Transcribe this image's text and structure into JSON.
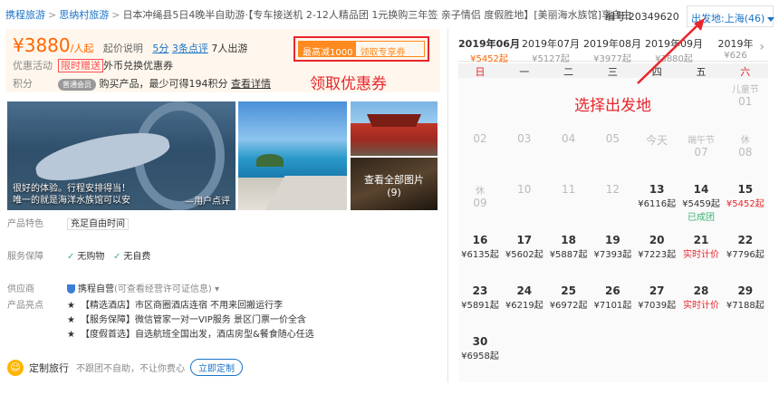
{
  "breadcrumb": {
    "item1": "携程旅游",
    "item2": "思纳村旅游",
    "title": "日本冲绳县5日4晚半自助游·【专车接送机 2-12人精品团 1元换购三年签 亲子情侣 度假胜地】[美丽海水族馆]享自由"
  },
  "product_number": "编号:20349620",
  "departure": {
    "label": "出发地:上海(46)"
  },
  "price": {
    "currency": "¥",
    "amount": "3880",
    "unit": "/人起",
    "explain": "起价说明",
    "score": "5分",
    "reviews": "3条点评",
    "travelers": "7人出游"
  },
  "promo": {
    "label": "优惠活动",
    "tag": "限时赠送",
    "text": "外币兑换优惠券"
  },
  "points": {
    "label": "积分",
    "pill": "普通会员",
    "text": "购买产品，最少可得194积分",
    "link": "查看详情"
  },
  "coupon": {
    "a": "最高减1000",
    "b": "领取专享券"
  },
  "annotations": {
    "coupon_note": "领取优惠券",
    "departure_note": "选择出发地"
  },
  "images": {
    "main_caption_1": "很好的体验。行程安排得当！",
    "main_caption_2": "唯一的就是海洋水族馆可以安",
    "main_caption_3": "—用户点评",
    "all_label": "查看全部图片",
    "all_count": "(9)"
  },
  "attributes": {
    "feature_k": "产品特色",
    "feature_v": "充足自由时间",
    "guarantee_k": "服务保障",
    "guarantee_v1": "无购物",
    "guarantee_v2": "无自费",
    "supplier_k": "供应商",
    "supplier_v": "携程自营",
    "supplier_note": "(可查看经营许可证信息)",
    "highlight_k": "产品亮点",
    "h1": "【精选酒店】市区商圈酒店连宿 不用来回搬运行李",
    "h2": "【服务保障】微信管家一对一VIP服务 景区门票一价全含",
    "h3": "【度假首选】自选航班全国出发，酒店房型&餐食随心任选"
  },
  "custom": {
    "icon": "☺",
    "title": "定制旅行",
    "sub": "不跟团不自助，不让你费心",
    "button": "立即定制"
  },
  "calendar": {
    "months": [
      {
        "m": "2019年06月",
        "p": "¥5452起"
      },
      {
        "m": "2019年07月",
        "p": "¥5127起"
      },
      {
        "m": "2019年08月",
        "p": "¥3977起"
      },
      {
        "m": "2019年09月",
        "p": "¥3880起"
      },
      {
        "m": "2019年",
        "p": "¥626"
      }
    ],
    "weekdays": [
      "日",
      "一",
      "二",
      "三",
      "四",
      "五",
      "六"
    ],
    "cells": [
      {
        "n": "01",
        "h": "儿童节",
        "col": 6,
        "row": 0,
        "dim": true
      },
      {
        "n": "02",
        "col": 0,
        "row": 1,
        "dim": true
      },
      {
        "n": "03",
        "col": 1,
        "row": 1,
        "dim": true
      },
      {
        "n": "04",
        "col": 2,
        "row": 1,
        "dim": true
      },
      {
        "n": "05",
        "col": 3,
        "row": 1,
        "dim": true
      },
      {
        "n": "今天",
        "col": 4,
        "row": 1,
        "dim": true
      },
      {
        "n": "07",
        "h": "端午节",
        "col": 5,
        "row": 1,
        "dim": true
      },
      {
        "n": "08",
        "h": "休",
        "col": 6,
        "row": 1,
        "dim": true
      },
      {
        "n": "09",
        "h": "休",
        "col": 0,
        "row": 2,
        "dim": true
      },
      {
        "n": "10",
        "col": 1,
        "row": 2,
        "dim": true
      },
      {
        "n": "11",
        "col": 2,
        "row": 2,
        "dim": true
      },
      {
        "n": "12",
        "col": 3,
        "row": 2,
        "dim": true
      },
      {
        "n": "13",
        "p": "¥6116起",
        "col": 4,
        "row": 2
      },
      {
        "n": "14",
        "p": "¥5459起",
        "s": "已成团",
        "col": 5,
        "row": 2
      },
      {
        "n": "15",
        "p": "¥5452起",
        "col": 6,
        "row": 2,
        "we": true
      },
      {
        "n": "16",
        "p": "¥6135起",
        "col": 0,
        "row": 3
      },
      {
        "n": "17",
        "p": "¥5602起",
        "col": 1,
        "row": 3
      },
      {
        "n": "18",
        "p": "¥5887起",
        "col": 2,
        "row": 3
      },
      {
        "n": "19",
        "p": "¥7393起",
        "col": 3,
        "row": 3
      },
      {
        "n": "20",
        "p": "¥7223起",
        "col": 4,
        "row": 3
      },
      {
        "n": "21",
        "p": "实时计价",
        "col": 5,
        "row": 3,
        "live": true
      },
      {
        "n": "22",
        "p": "¥7796起",
        "col": 6,
        "row": 3
      },
      {
        "n": "23",
        "p": "¥5891起",
        "col": 0,
        "row": 4
      },
      {
        "n": "24",
        "p": "¥6219起",
        "col": 1,
        "row": 4
      },
      {
        "n": "25",
        "p": "¥6972起",
        "col": 2,
        "row": 4
      },
      {
        "n": "26",
        "p": "¥7101起",
        "col": 3,
        "row": 4
      },
      {
        "n": "27",
        "p": "¥7039起",
        "col": 4,
        "row": 4
      },
      {
        "n": "28",
        "p": "实时计价",
        "col": 5,
        "row": 4,
        "live": true
      },
      {
        "n": "29",
        "p": "¥7188起",
        "col": 6,
        "row": 4
      },
      {
        "n": "30",
        "p": "¥6958起",
        "col": 0,
        "row": 5
      }
    ]
  },
  "colors": {
    "accent": "#1a73c8",
    "price": "#ff6600",
    "alert": "#e8262b"
  }
}
